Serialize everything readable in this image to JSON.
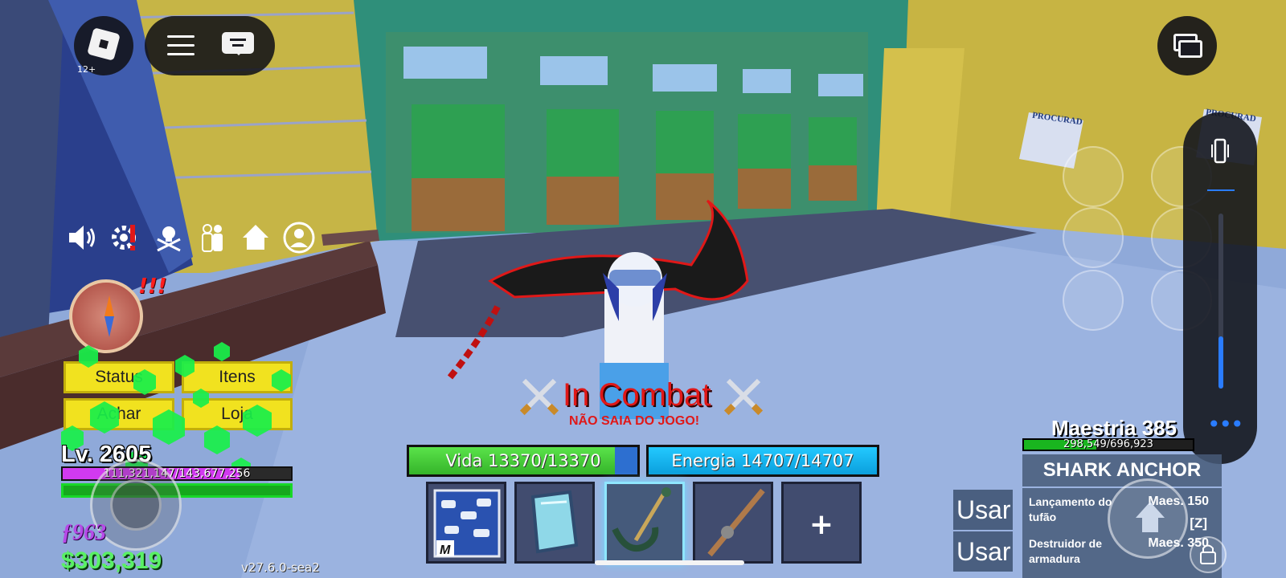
{
  "top_left": {
    "age_rating": "12+"
  },
  "hud": {
    "buttons": [
      "Status",
      "Itens",
      "Achar",
      "Loja"
    ],
    "alert": "!!!",
    "level": "Lv. 2605",
    "xp_text": "111,321,147/143,677,256",
    "xp_progress": 0.775,
    "fragments": "ƒ963",
    "beli": "$303,319",
    "version": "v27.6.0-sea2"
  },
  "combat": {
    "title": "In Combat",
    "warning": "NÃO SAIA DO JOGO!"
  },
  "stats": {
    "vida": "Vida 13370/13370",
    "energia": "Energia 14707/14707"
  },
  "hotbar": {
    "slots": [
      "fighting-style",
      "glass-shield",
      "shark-anchor",
      "fishing-rod",
      "+"
    ],
    "active_index": 2,
    "badge_letter": "M"
  },
  "weapon": {
    "mastery_label": "Maestria 385",
    "mastery_text": "298,549/696,923",
    "mastery_progress": 0.428,
    "name": "SHARK ANCHOR",
    "skills": [
      {
        "name": "Lançamento do tufão",
        "mastery": "Maes. 150",
        "key": "[Z]"
      },
      {
        "name": "Destruidor de armadura",
        "mastery": "Maes. 350",
        "key": ""
      }
    ],
    "use_labels": [
      "Usar",
      "Usar"
    ]
  },
  "wanted_posters": [
    "PROCURAD",
    "PROCURAD"
  ],
  "volume_level": 0.3,
  "colors": {
    "health": "#35b42a",
    "energy": "#0b9fdc",
    "combat": "#e01818",
    "beli": "#5af065",
    "fragments": "#b64ae8",
    "panel": "#14161e",
    "accent": "#2a7cff"
  }
}
